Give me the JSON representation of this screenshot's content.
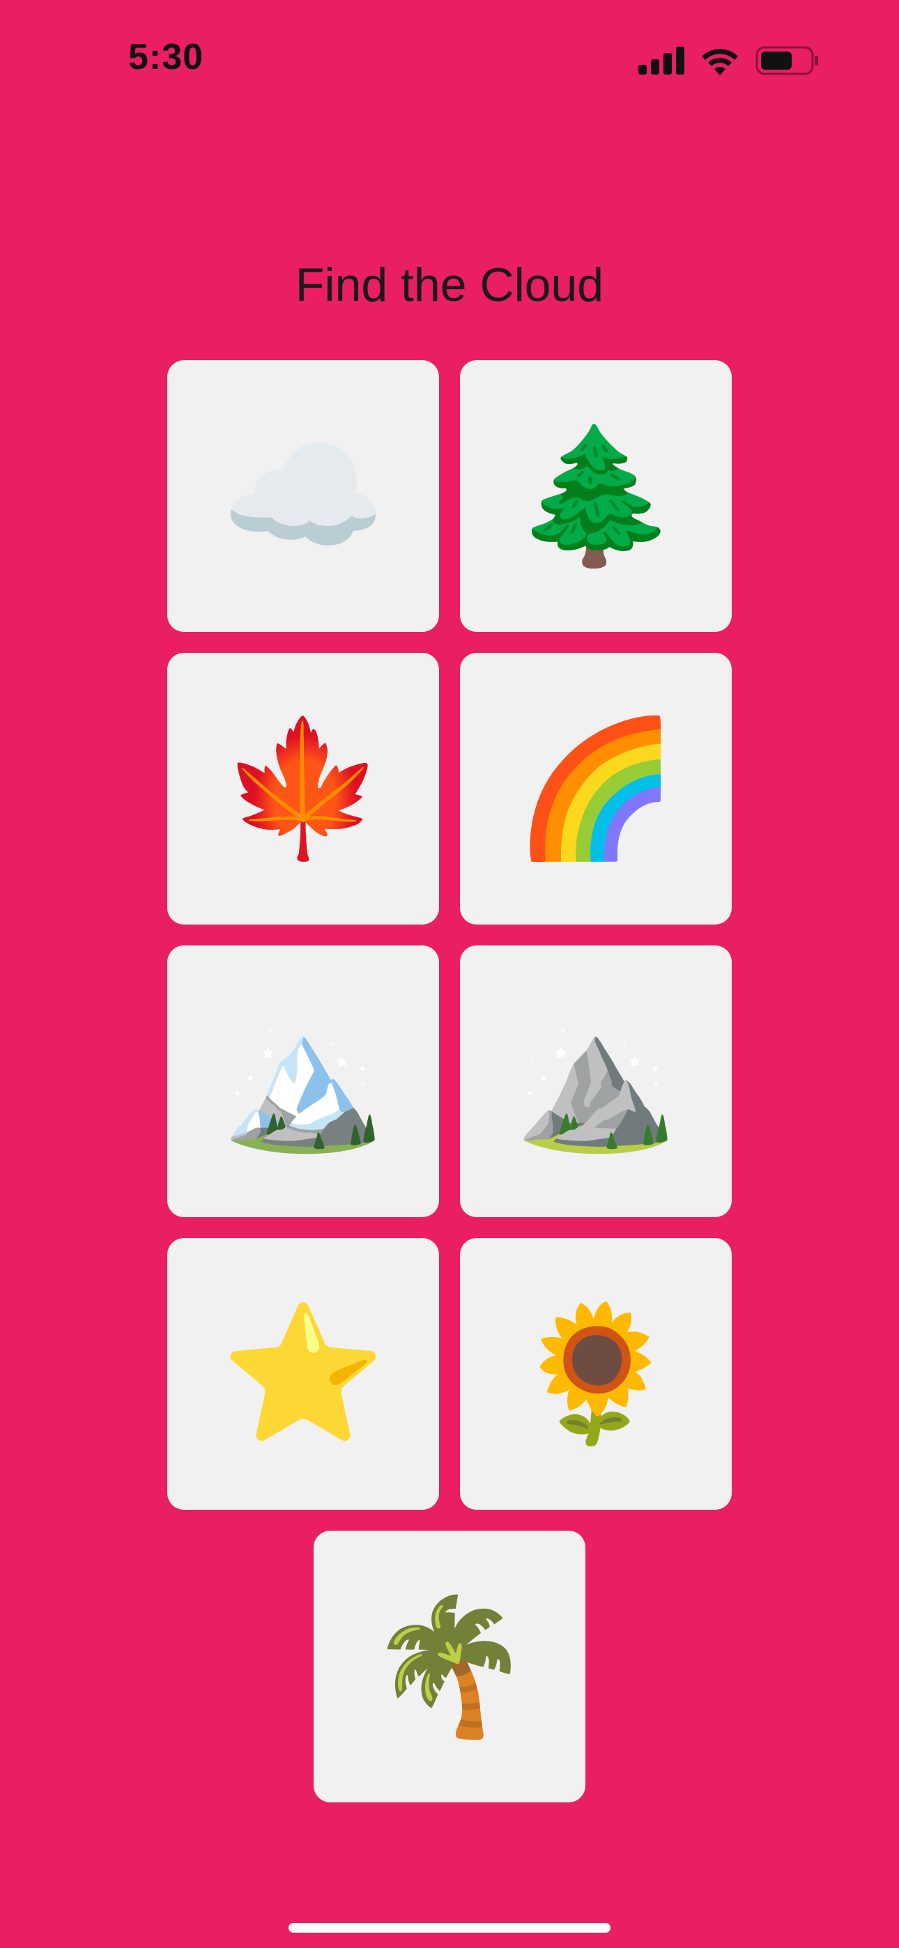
{
  "status_bar": {
    "time": "5:30",
    "icons": [
      "cellular-signal-icon",
      "wifi-icon",
      "battery-icon"
    ]
  },
  "title": "Find the Cloud",
  "tiles": [
    {
      "icon": "cloud-icon",
      "emoji": "☁️"
    },
    {
      "icon": "evergreen-tree-icon",
      "emoji": "🌲"
    },
    {
      "icon": "maple-leaf-icon",
      "emoji": "🍁"
    },
    {
      "icon": "rainbow-icon",
      "emoji": "🌈"
    },
    {
      "icon": "snow-capped-mountain-icon",
      "emoji": "🏔️"
    },
    {
      "icon": "mountain-icon",
      "emoji": "⛰️"
    },
    {
      "icon": "star-icon",
      "emoji": "⭐"
    },
    {
      "icon": "sunflower-icon",
      "emoji": "🌻"
    },
    {
      "icon": "palm-tree-icon",
      "emoji": "🌴"
    }
  ],
  "colors": {
    "background": "#E91E63",
    "tile": "#F1F1F1",
    "text": "#1A1A1A"
  }
}
